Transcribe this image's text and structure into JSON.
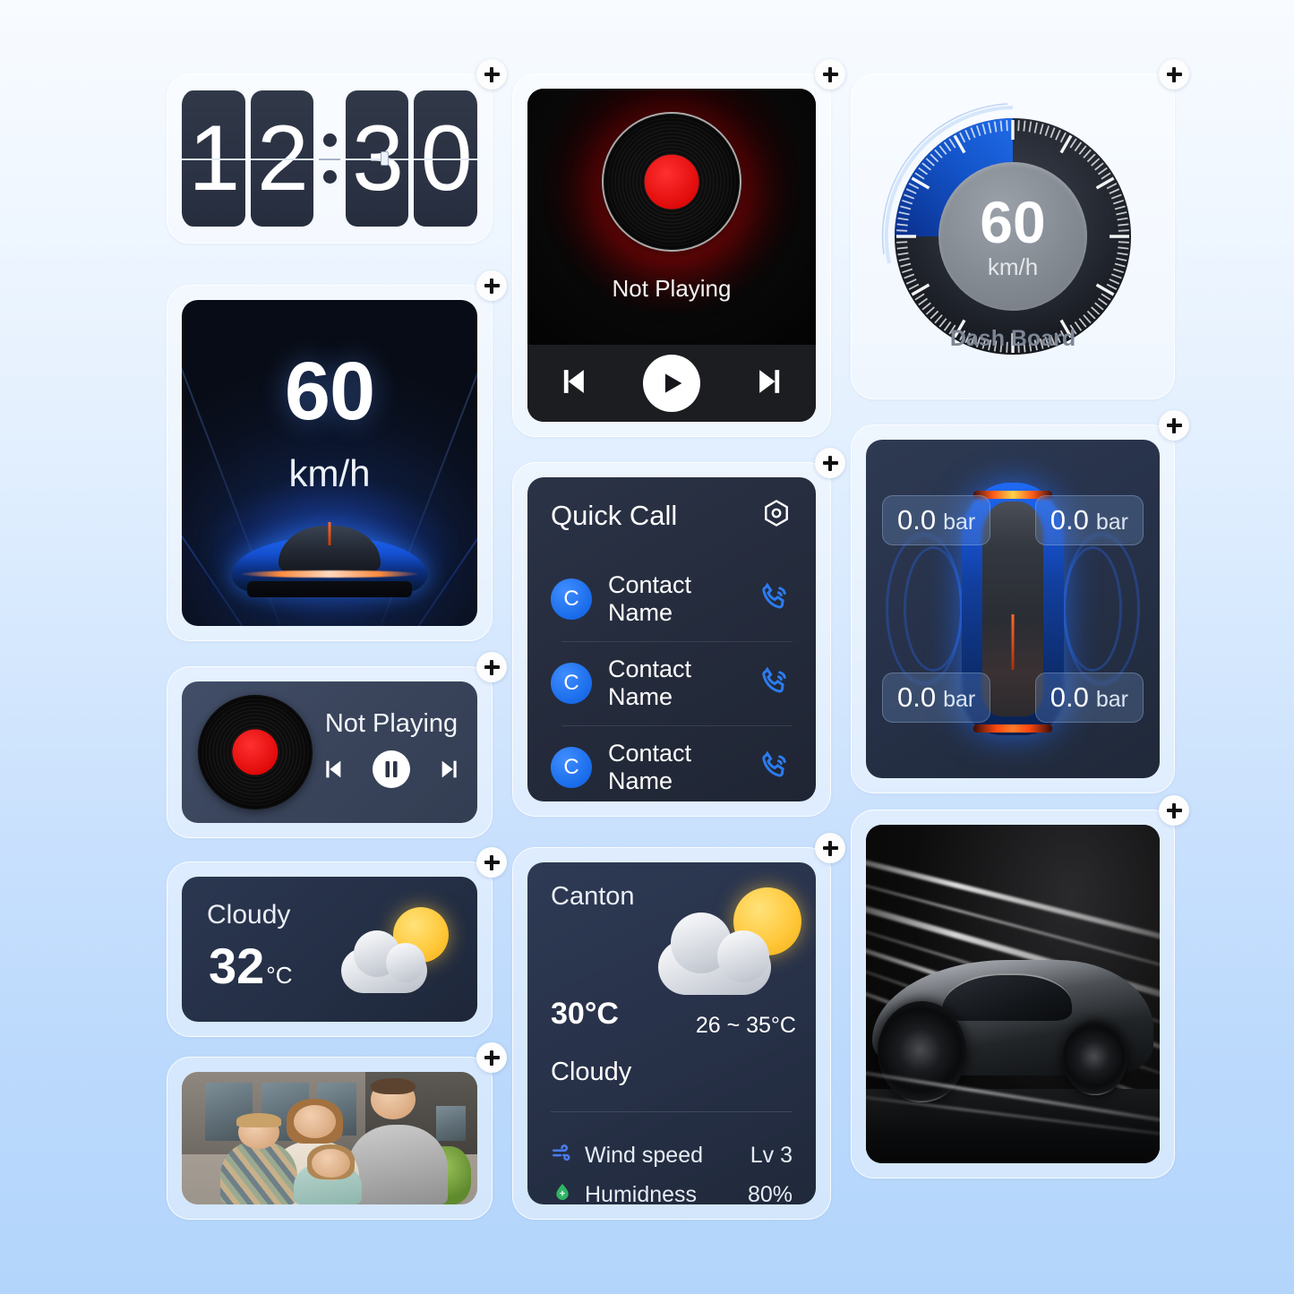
{
  "background": {
    "top_color": "#f8fbff",
    "bottom_color": "#b3d5fb"
  },
  "add_button": {
    "label": "+",
    "icon": "plus-icon"
  },
  "widgets": {
    "clock": {
      "name": "flip-clock",
      "digits": [
        "1",
        "2",
        "3",
        "0"
      ],
      "separator": ":",
      "time": "12:30"
    },
    "speed_hud": {
      "name": "speed-hud",
      "value": "60",
      "unit": "km/h"
    },
    "music_mini": {
      "name": "mini-music-player",
      "title": "Not Playing",
      "controls": {
        "previous": "previous-track-icon",
        "playpause": "pause-icon",
        "next": "next-track-icon"
      }
    },
    "weather_small": {
      "name": "weather-compact",
      "condition": "Cloudy",
      "temperature": "32",
      "unit": "°C",
      "icon": "sun-behind-cloud-icon"
    },
    "photo": {
      "name": "photo-frame",
      "alt": "Family portrait outdoors"
    },
    "music_big": {
      "name": "music-player",
      "title": "Not Playing",
      "controls": {
        "previous": "previous-track-icon",
        "play": "play-icon",
        "next": "next-track-icon"
      }
    },
    "quick_call": {
      "name": "quick-call",
      "title": "Quick Call",
      "settings_icon": "hexagon-settings-icon",
      "contacts": [
        {
          "initial": "C",
          "name": "Contact Name",
          "action_icon": "phone-call-icon"
        },
        {
          "initial": "C",
          "name": "Contact Name",
          "action_icon": "phone-call-icon"
        },
        {
          "initial": "C",
          "name": "Contact Name",
          "action_icon": "phone-call-icon"
        }
      ]
    },
    "weather_big": {
      "name": "weather-detail",
      "city": "Canton",
      "temperature": "30",
      "unit": "°C",
      "range": "26 ~ 35°C",
      "condition": "Cloudy",
      "icon": "sun-behind-cloud-icon",
      "stats": [
        {
          "icon": "wind-icon",
          "label": "Wind speed",
          "value": "Lv 3",
          "color": "#4a7df0"
        },
        {
          "icon": "humidity-droplet-icon",
          "label": "Humidness",
          "value": "80%",
          "color": "#2fb463"
        }
      ]
    },
    "dashboard": {
      "name": "dashboard-gauge",
      "value": "60",
      "unit": "km/h",
      "label": "Dash Board",
      "arc_color": "#1353c8",
      "fill_percent": 35
    },
    "tire_pressure": {
      "name": "tire-pressure-monitor",
      "tires": [
        {
          "position": "front-left",
          "value": "0.0",
          "unit": "bar"
        },
        {
          "position": "front-right",
          "value": "0.0",
          "unit": "bar"
        },
        {
          "position": "rear-left",
          "value": "0.0",
          "unit": "bar"
        },
        {
          "position": "rear-right",
          "value": "0.0",
          "unit": "bar"
        }
      ]
    },
    "car_wallpaper": {
      "name": "car-wallpaper",
      "alt": "Silver sports car with light streaks"
    }
  }
}
